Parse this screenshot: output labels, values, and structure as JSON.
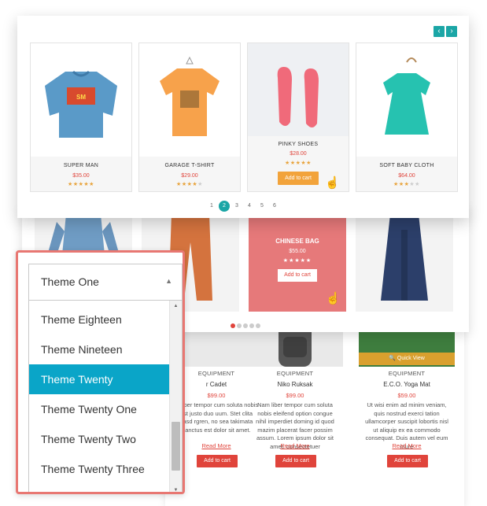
{
  "top_slider": {
    "prev_icon": "‹",
    "next_icon": "›",
    "products": [
      {
        "name": "SUPER MAN",
        "price": "$35.00",
        "rating": 5
      },
      {
        "name": "GARAGE T-SHIRT",
        "price": "$29.00",
        "rating": 4
      },
      {
        "name": "PINKY SHOES",
        "price": "$28.00",
        "rating": 5,
        "add_to_cart": "Add to cart"
      },
      {
        "name": "SOFT BABY CLOTH",
        "price": "$64.00",
        "rating": 3
      }
    ],
    "pagination": [
      "1",
      "2",
      "3",
      "4",
      "5",
      "6"
    ],
    "current_page": "2"
  },
  "middle_slider": {
    "highlight": {
      "name": "CHINESE BAG",
      "price": "$55.00",
      "rating": 5,
      "add_to_cart": "Add to cart"
    },
    "dots": 5,
    "active_dot": 1
  },
  "bottom_grid": {
    "products": [
      {
        "category": "EQUIPMENT",
        "name": "r Cadet",
        "price": "$99.00",
        "description": "m liber tempor cum soluta nobis est justo duo uum. Stet clita kasd rgren, no sea takimata sanctus est dolor sit amet.",
        "read_more": "Read More",
        "add_to_cart": "Add to cart"
      },
      {
        "category": "EQUIPMENT",
        "name": "Niko Ruksak",
        "price": "$99.00",
        "description": "Nam liber tempor cum soluta nobis eleifend option congue nihil imperdiet doming id quod mazim placerat facer possim assum. Lorem ipsum dolor sit amet, consectetuer",
        "read_more": "Read More",
        "add_to_cart": "Add to cart"
      },
      {
        "category": "EQUIPMENT",
        "name": "E.C.O. Yoga Mat",
        "price": "$59.00",
        "description": "Ut wisi enim ad minim veniam, quis nostrud exerci tation ullamcorper suscipit lobortis nisl ut aliquip ex ea commodo consequat. Duis autem vel eum iriure",
        "read_more": "Read More",
        "add_to_cart": "Add to cart",
        "quick_view": "Quick View"
      }
    ]
  },
  "theme_select": {
    "selected": "Theme One",
    "options": [
      "Theme Eighteen",
      "Theme Nineteen",
      "Theme Twenty",
      "Theme Twenty One",
      "Theme Twenty Two",
      "Theme Twenty Three"
    ],
    "highlighted": "Theme Twenty"
  },
  "colors": {
    "accent_teal": "#1ba6a6",
    "highlight_blue": "#0aa5c8",
    "sale_red": "#e0443b",
    "cart_orange": "#f2a33b",
    "frame_red": "#e87772"
  }
}
